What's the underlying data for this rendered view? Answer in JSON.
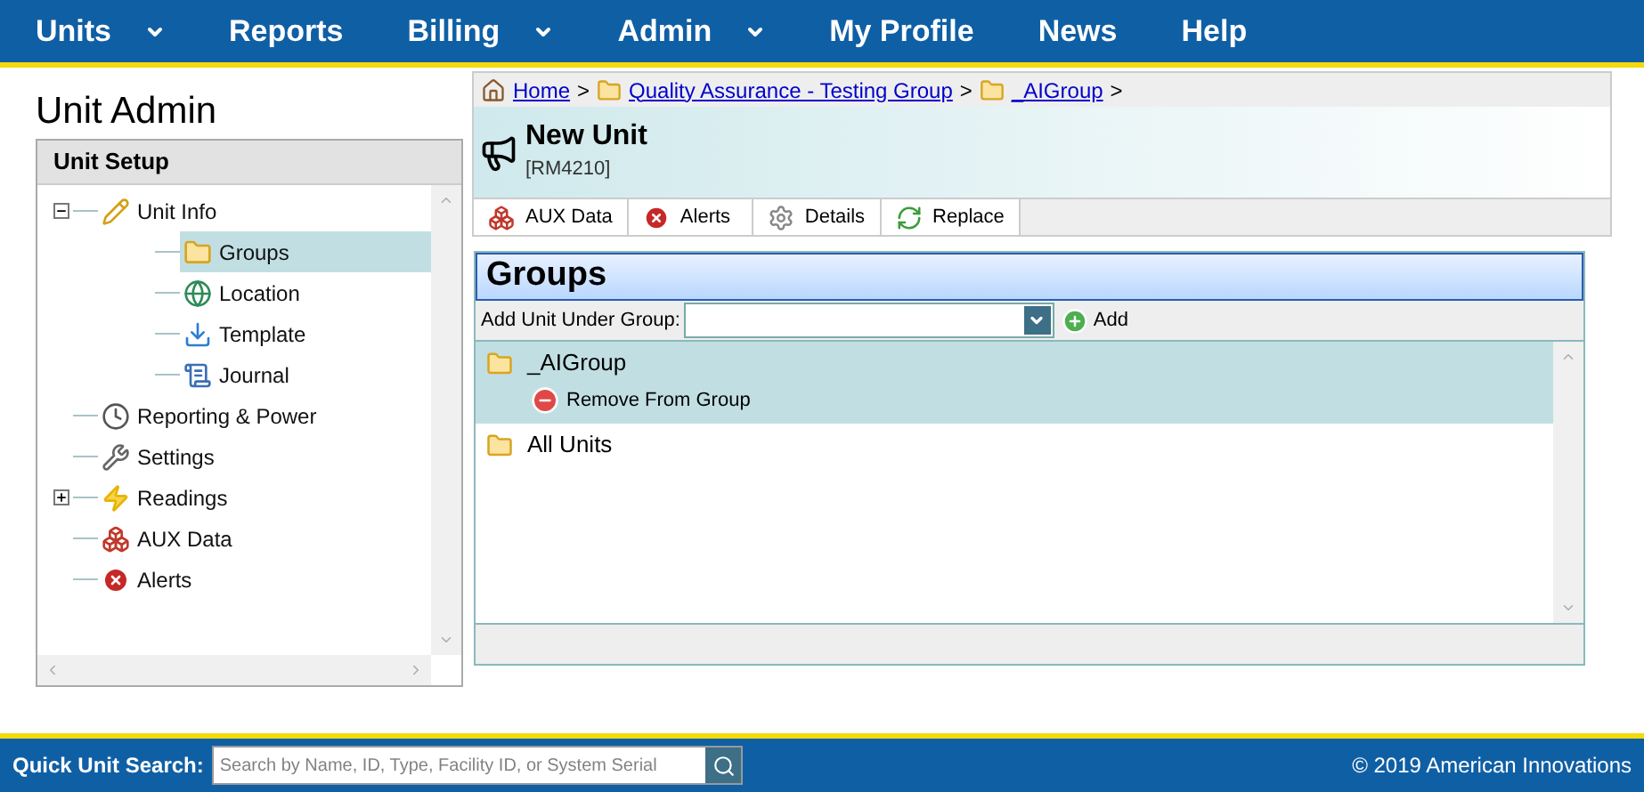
{
  "nav": [
    {
      "label": "Units",
      "dropdown": true
    },
    {
      "label": "Reports",
      "dropdown": false
    },
    {
      "label": "Billing",
      "dropdown": true
    },
    {
      "label": "Admin",
      "dropdown": true
    },
    {
      "label": "My Profile",
      "dropdown": false
    },
    {
      "label": "News",
      "dropdown": false
    },
    {
      "label": "Help",
      "dropdown": false
    }
  ],
  "page_title": "Unit Admin",
  "tree": {
    "title": "Unit Setup",
    "items": [
      {
        "label": "Unit Info",
        "kind": "pencil",
        "selected": false,
        "expanded": true,
        "children": [
          {
            "label": "Groups",
            "kind": "folder",
            "selected": true
          },
          {
            "label": "Location",
            "kind": "globe",
            "selected": false
          },
          {
            "label": "Template",
            "kind": "download",
            "selected": false
          },
          {
            "label": "Journal",
            "kind": "scroll",
            "selected": false
          }
        ]
      },
      {
        "label": "Reporting & Power",
        "kind": "clock",
        "selected": false
      },
      {
        "label": "Settings",
        "kind": "wrench",
        "selected": false
      },
      {
        "label": "Readings",
        "kind": "bolt",
        "selected": false,
        "expanded": false
      },
      {
        "label": "AUX Data",
        "kind": "boxes",
        "selected": false
      },
      {
        "label": "Alerts",
        "kind": "alert",
        "selected": false
      }
    ]
  },
  "breadcrumb": [
    {
      "label": "Home",
      "kind": "home"
    },
    {
      "label": "Quality Assurance - Testing Group",
      "kind": "folder"
    },
    {
      "label": "_AIGroup",
      "kind": "folder"
    }
  ],
  "breadcrumb_separator": ">",
  "unit": {
    "name": "New Unit",
    "id": "[RM4210]"
  },
  "toolbar": [
    {
      "label": "AUX Data",
      "kind": "boxes"
    },
    {
      "label": "Alerts",
      "kind": "alert"
    },
    {
      "label": "Details",
      "kind": "gear"
    },
    {
      "label": "Replace",
      "kind": "refresh"
    }
  ],
  "groups": {
    "title": "Groups",
    "add_label": "Add Unit Under Group:",
    "add_button": "Add",
    "rows": [
      {
        "label": "_AIGroup",
        "selected": true,
        "action": "Remove From Group"
      },
      {
        "label": "All Units",
        "selected": false
      }
    ]
  },
  "footer": {
    "search_label": "Quick Unit Search:",
    "search_placeholder": "Search by Name, ID, Type, Facility ID, or System Serial",
    "copyright": "© 2019 American Innovations"
  }
}
